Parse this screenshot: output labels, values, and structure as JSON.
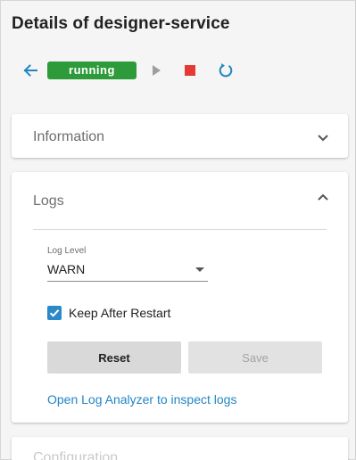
{
  "page": {
    "title": "Details of designer-service"
  },
  "toolbar": {
    "status_label": "running",
    "status_color": "#2e9b3a",
    "icons": {
      "back": "arrow-left-icon",
      "play": "play-icon",
      "stop": "stop-icon",
      "restart": "restart-icon"
    }
  },
  "sections": {
    "information": {
      "title": "Information",
      "expanded": false
    },
    "logs": {
      "title": "Logs",
      "expanded": true,
      "log_level_label": "Log Level",
      "log_level_value": "WARN",
      "keep_after_restart_label": "Keep After Restart",
      "keep_after_restart_checked": true,
      "reset_label": "Reset",
      "save_label": "Save",
      "save_enabled": false,
      "analyzer_link": "Open Log Analyzer to inspect logs"
    },
    "configuration": {
      "title": "Configuration"
    }
  },
  "colors": {
    "accent": "#2185c5",
    "stop": "#e53935",
    "play_disabled": "#9e9e9e"
  }
}
